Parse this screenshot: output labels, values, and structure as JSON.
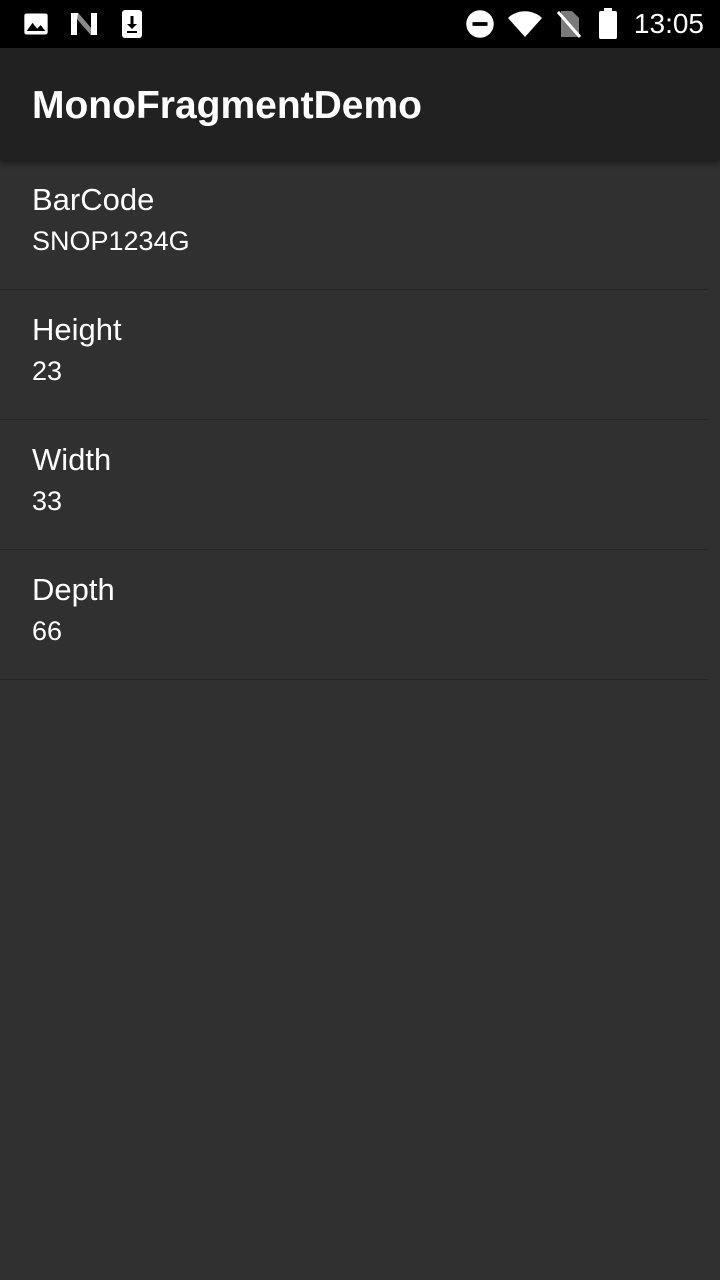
{
  "status_bar": {
    "time": "13:05",
    "left_icons": [
      "image-icon",
      "n-logo-icon",
      "download-icon"
    ],
    "right_icons": [
      "do-not-disturb-icon",
      "wifi-icon",
      "no-sim-icon",
      "battery-icon"
    ]
  },
  "app_bar": {
    "title": "MonoFragmentDemo"
  },
  "items": [
    {
      "label": "BarCode",
      "value": "SNOP1234G"
    },
    {
      "label": "Height",
      "value": "23"
    },
    {
      "label": "Width",
      "value": "33"
    },
    {
      "label": "Depth",
      "value": "66"
    }
  ],
  "colors": {
    "status_bar_bg": "#000000",
    "app_bar_bg": "#212121",
    "content_bg": "#303030",
    "divider": "#262626",
    "text": "#ffffff"
  }
}
